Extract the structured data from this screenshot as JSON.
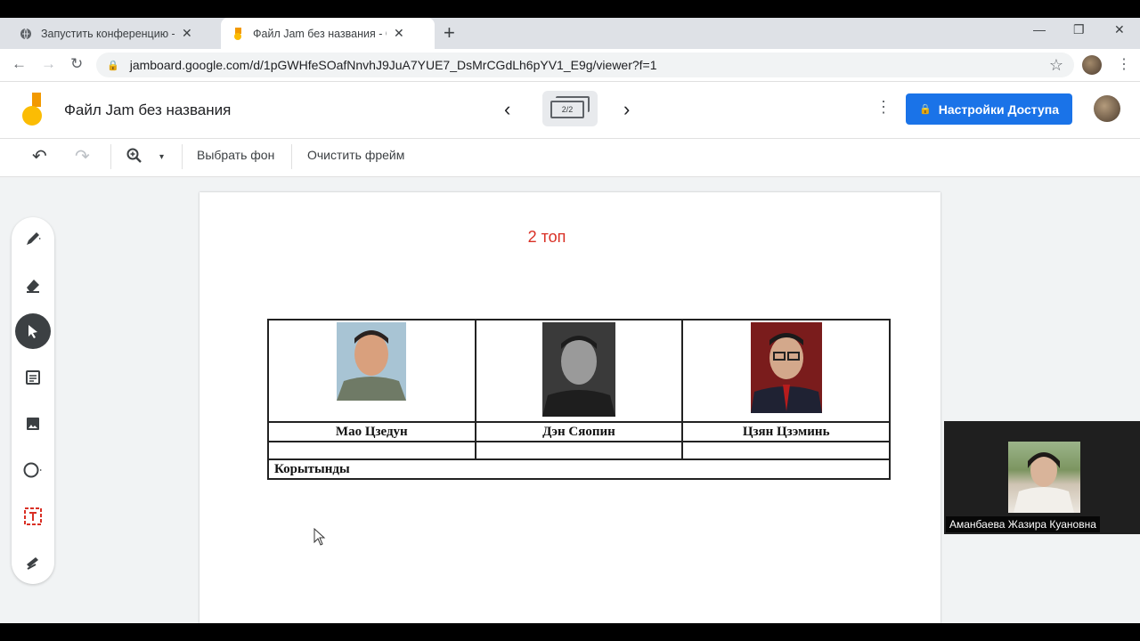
{
  "browser": {
    "tabs": [
      {
        "title": "Запустить конференцию - Zoom",
        "close": "✕",
        "active": false
      },
      {
        "title": "Файл Jam без названия - Google",
        "close": "✕",
        "active": true
      }
    ],
    "new_tab": "+",
    "window_controls": {
      "minimize": "—",
      "restore": "❐",
      "close": "✕"
    },
    "nav": {
      "back": "←",
      "forward": "→",
      "reload": "↻"
    },
    "url": "jamboard.google.com/d/1pGWHfeSOafNnvhJ9JuA7YUE7_DsMrCGdLh6pYV1_E9g/viewer?f=1",
    "bookmark_star": "☆",
    "menu": "⋮"
  },
  "jamboard": {
    "title": "Файл Jam без названия",
    "frame_indicator": "2/2",
    "prev": "‹",
    "next": "›",
    "more": "⋮",
    "share_label": "Настройки Доступа"
  },
  "toolbar": {
    "undo": "↶",
    "redo": "↷",
    "zoom": "🔍",
    "zoom_dropdown": "▾",
    "set_background": "Выбрать фон",
    "clear_frame": "Очистить фрейм"
  },
  "tools": [
    {
      "name": "pen-tool",
      "icon": "pen-icon",
      "glyph": "✎"
    },
    {
      "name": "eraser-tool",
      "icon": "eraser-icon",
      "glyph": "⌫"
    },
    {
      "name": "select-tool",
      "icon": "cursor-icon",
      "glyph": "➤"
    },
    {
      "name": "sticky-note-tool",
      "icon": "sticky-note-icon",
      "glyph": "▤"
    },
    {
      "name": "image-tool",
      "icon": "image-icon",
      "glyph": "▣"
    },
    {
      "name": "circle-tool",
      "icon": "circle-icon",
      "glyph": "○"
    },
    {
      "name": "text-box-tool",
      "icon": "text-box-icon",
      "glyph": "T"
    },
    {
      "name": "laser-tool",
      "icon": "laser-icon",
      "glyph": "✐"
    }
  ],
  "board": {
    "heading": "2 топ",
    "table": {
      "names": [
        "Мао Цзедун",
        "Дэн Сяопин",
        "Цзян Цзэминь"
      ],
      "footer": "Корытынды"
    }
  },
  "participant": {
    "name": "Аманбаева Жазира Куановна"
  },
  "colors": {
    "accent": "#1a73e8",
    "heading_red": "#d93025",
    "logo_yellow": "#fbbc04",
    "logo_orange": "#f29900"
  }
}
